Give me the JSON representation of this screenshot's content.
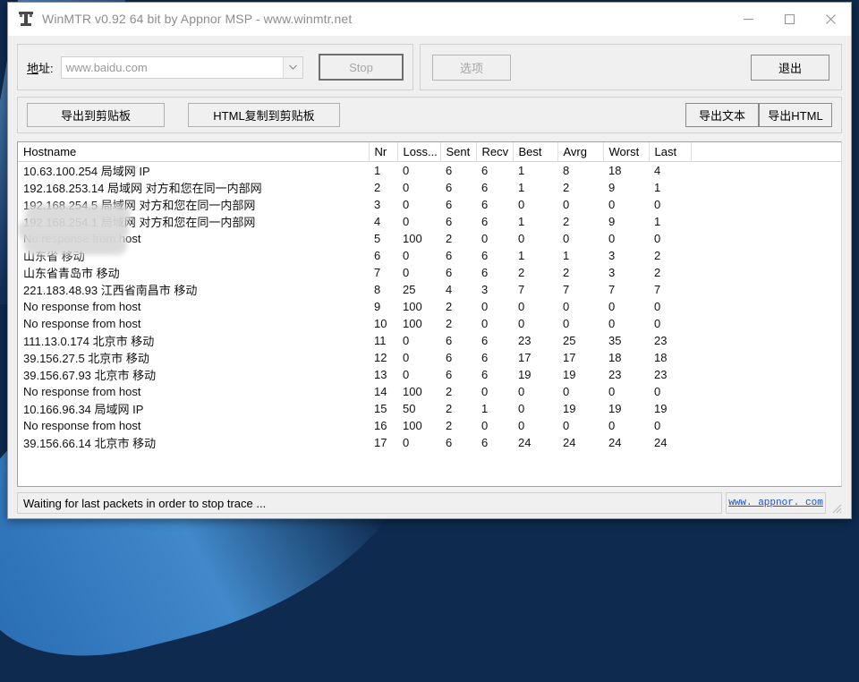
{
  "window": {
    "title": "WinMTR v0.92 64 bit by Appnor MSP - www.winmtr.net",
    "app_icon": "antenna-tower-icon",
    "minimize_label": "minimize-icon",
    "maximize_label": "maximize-icon",
    "close_label": "close-icon"
  },
  "address_bar": {
    "label": "地址:",
    "value": "www.baidu.com",
    "placeholder": "www.baidu.com",
    "dropdown_icon": "chevron-down-icon",
    "stop_button": "Stop",
    "stop_disabled": true
  },
  "options_bar": {
    "options_button": "选项",
    "options_disabled": true,
    "exit_button": "退出"
  },
  "export_bar": {
    "copy_text_button": "导出到剪贴板",
    "copy_html_button": "HTML复制到剪贴板",
    "export_text_button": "导出文本",
    "export_html_button": "导出HTML"
  },
  "table": {
    "columns": [
      "Hostname",
      "Nr",
      "Loss...",
      "Sent",
      "Recv",
      "Best",
      "Avrg",
      "Worst",
      "Last"
    ],
    "rows": [
      {
        "hostname": "10.63.100.254 局域网 IP",
        "nr": "1",
        "loss": "0",
        "sent": "6",
        "recv": "6",
        "best": "1",
        "avrg": "8",
        "worst": "18",
        "last": "4",
        "redacted": false
      },
      {
        "hostname": "192.168.253.14 局域网 对方和您在同一内部网",
        "nr": "2",
        "loss": "0",
        "sent": "6",
        "recv": "6",
        "best": "1",
        "avrg": "2",
        "worst": "9",
        "last": "1",
        "redacted": false
      },
      {
        "hostname": "192.168.254.5 局域网 对方和您在同一内部网",
        "nr": "3",
        "loss": "0",
        "sent": "6",
        "recv": "6",
        "best": "0",
        "avrg": "0",
        "worst": "0",
        "last": "0",
        "redacted": false
      },
      {
        "hostname": "192.168.254.1 局域网 对方和您在同一内部网",
        "nr": "4",
        "loss": "0",
        "sent": "6",
        "recv": "6",
        "best": "1",
        "avrg": "2",
        "worst": "9",
        "last": "1",
        "redacted": false
      },
      {
        "hostname": "No response from host",
        "nr": "5",
        "loss": "100",
        "sent": "2",
        "recv": "0",
        "best": "0",
        "avrg": "0",
        "worst": "0",
        "last": "0",
        "redacted": true
      },
      {
        "hostname": "山东省 移动",
        "nr": "6",
        "loss": "0",
        "sent": "6",
        "recv": "6",
        "best": "1",
        "avrg": "1",
        "worst": "3",
        "last": "2",
        "redacted": true
      },
      {
        "hostname": "山东省青岛市 移动",
        "nr": "7",
        "loss": "0",
        "sent": "6",
        "recv": "6",
        "best": "2",
        "avrg": "2",
        "worst": "3",
        "last": "2",
        "redacted": true
      },
      {
        "hostname": "221.183.48.93 江西省南昌市 移动",
        "nr": "8",
        "loss": "25",
        "sent": "4",
        "recv": "3",
        "best": "7",
        "avrg": "7",
        "worst": "7",
        "last": "7",
        "redacted": true
      },
      {
        "hostname": "No response from host",
        "nr": "9",
        "loss": "100",
        "sent": "2",
        "recv": "0",
        "best": "0",
        "avrg": "0",
        "worst": "0",
        "last": "0",
        "redacted": false
      },
      {
        "hostname": "No response from host",
        "nr": "10",
        "loss": "100",
        "sent": "2",
        "recv": "0",
        "best": "0",
        "avrg": "0",
        "worst": "0",
        "last": "0",
        "redacted": false
      },
      {
        "hostname": "111.13.0.174 北京市 移动",
        "nr": "11",
        "loss": "0",
        "sent": "6",
        "recv": "6",
        "best": "23",
        "avrg": "25",
        "worst": "35",
        "last": "23",
        "redacted": false
      },
      {
        "hostname": "39.156.27.5 北京市 移动",
        "nr": "12",
        "loss": "0",
        "sent": "6",
        "recv": "6",
        "best": "17",
        "avrg": "17",
        "worst": "18",
        "last": "18",
        "redacted": false
      },
      {
        "hostname": "39.156.67.93 北京市 移动",
        "nr": "13",
        "loss": "0",
        "sent": "6",
        "recv": "6",
        "best": "19",
        "avrg": "19",
        "worst": "23",
        "last": "23",
        "redacted": false
      },
      {
        "hostname": "No response from host",
        "nr": "14",
        "loss": "100",
        "sent": "2",
        "recv": "0",
        "best": "0",
        "avrg": "0",
        "worst": "0",
        "last": "0",
        "redacted": false
      },
      {
        "hostname": "10.166.96.34 局域网 IP",
        "nr": "15",
        "loss": "50",
        "sent": "2",
        "recv": "1",
        "best": "0",
        "avrg": "19",
        "worst": "19",
        "last": "19",
        "redacted": false
      },
      {
        "hostname": "No response from host",
        "nr": "16",
        "loss": "100",
        "sent": "2",
        "recv": "0",
        "best": "0",
        "avrg": "0",
        "worst": "0",
        "last": "0",
        "redacted": false
      },
      {
        "hostname": "39.156.66.14 北京市 移动",
        "nr": "17",
        "loss": "0",
        "sent": "6",
        "recv": "6",
        "best": "24",
        "avrg": "24",
        "worst": "24",
        "last": "24",
        "redacted": false
      }
    ]
  },
  "status_bar": {
    "message": "Waiting for last packets in order to stop trace ...",
    "link": "www. appnor. com",
    "link_color": "#1a4fcf"
  }
}
